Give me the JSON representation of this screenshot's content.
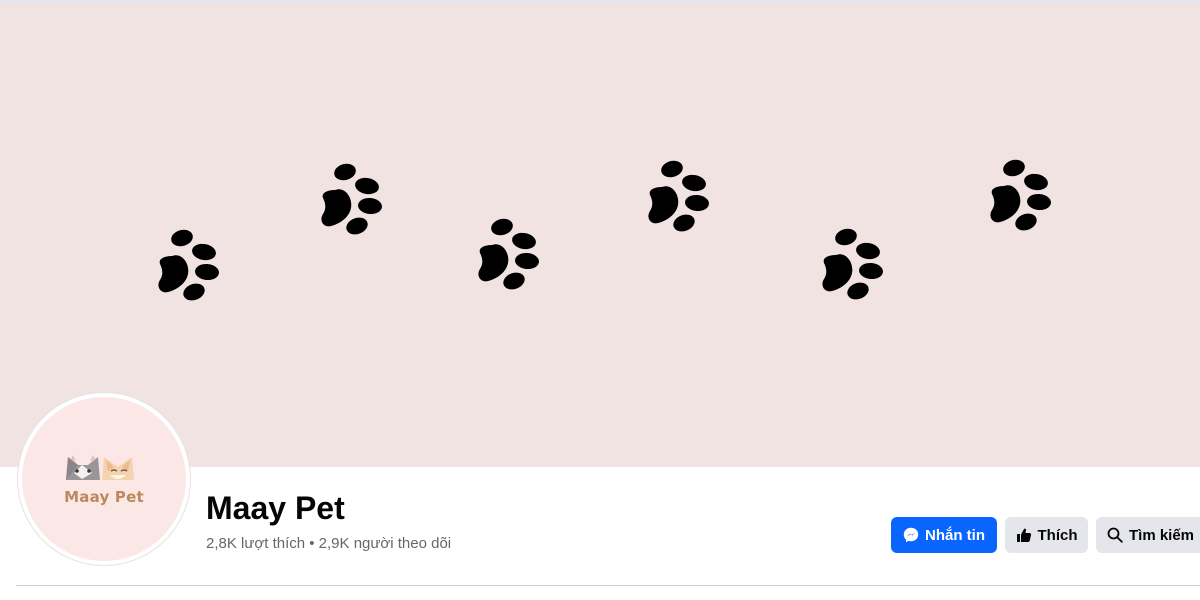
{
  "page": {
    "name": "Maay Pet",
    "stats": "2,8K lượt thích • 2,9K người theo dõi",
    "logo_text": "Maay Pet"
  },
  "actions": {
    "message_label": "Nhắn tin",
    "like_label": "Thích",
    "search_label": "Tìm kiếm"
  },
  "icons": {
    "message": "messenger-icon",
    "like": "thumbs-up-icon",
    "search": "search-icon",
    "cover": "paw-print-icon"
  },
  "colors": {
    "cover_background": "#f2e3e3",
    "paw": "#000000",
    "primary_button": "#0866ff",
    "secondary_button": "#e4e6eb",
    "secondary_text": "#65676b",
    "logo_text": "#b98a5c"
  }
}
